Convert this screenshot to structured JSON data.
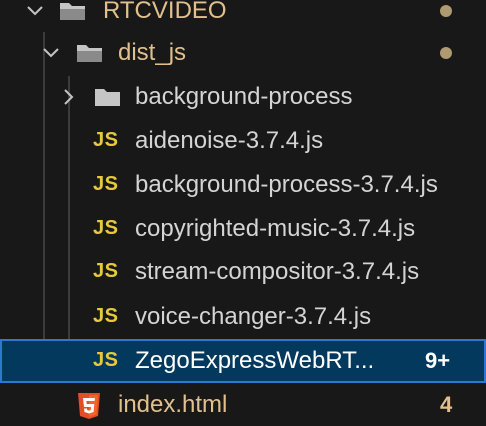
{
  "explorer": {
    "items": [
      {
        "label": "RTCVIDEO",
        "type": "folder",
        "expanded": true,
        "modified": true
      },
      {
        "label": "dist_js",
        "type": "folder",
        "expanded": true,
        "modified": true
      },
      {
        "label": "background-process",
        "type": "folder",
        "expanded": false
      },
      {
        "label": "aidenoise-3.7.4.js",
        "type": "js",
        "icon_text": "JS"
      },
      {
        "label": "background-process-3.7.4.js",
        "type": "js",
        "icon_text": "JS"
      },
      {
        "label": "copyrighted-music-3.7.4.js",
        "type": "js",
        "icon_text": "JS"
      },
      {
        "label": "stream-compositor-3.7.4.js",
        "type": "js",
        "icon_text": "JS"
      },
      {
        "label": "voice-changer-3.7.4.js",
        "type": "js",
        "icon_text": "JS"
      },
      {
        "label": "ZegoExpressWebRT...",
        "type": "js",
        "icon_text": "JS",
        "badge": "9+",
        "selected": true
      },
      {
        "label": "index.html",
        "type": "html",
        "badge": "4"
      }
    ]
  },
  "colors": {
    "background": "#181818",
    "selected_background": "#04395e",
    "selected_border": "#2b79d0",
    "modified_text": "#e2c08d",
    "js_icon": "#e8c93d",
    "html_icon": "#e44d26"
  }
}
